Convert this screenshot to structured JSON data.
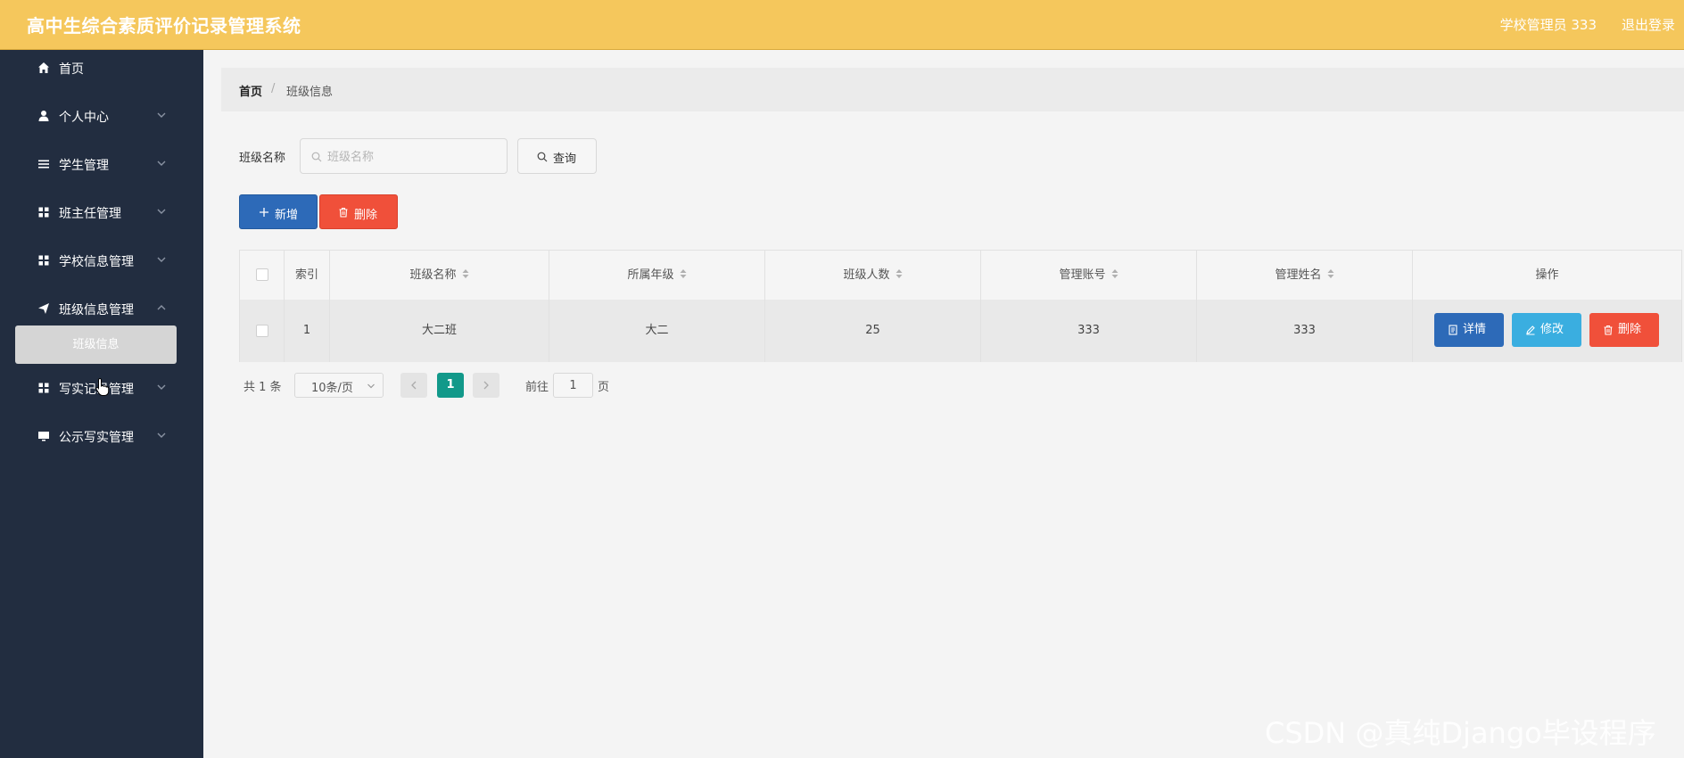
{
  "header": {
    "title": "高中生综合素质评价记录管理系统",
    "user": "学校管理员 333",
    "logout": "退出登录"
  },
  "sidebar": {
    "items": [
      {
        "label": "首页",
        "icon": "home-icon"
      },
      {
        "label": "个人中心",
        "icon": "user-icon"
      },
      {
        "label": "学生管理",
        "icon": "list-icon"
      },
      {
        "label": "班主任管理",
        "icon": "grid-icon"
      },
      {
        "label": "学校信息管理",
        "icon": "grid-icon"
      },
      {
        "label": "班级信息管理",
        "icon": "send-icon"
      },
      {
        "label": "写实记录管理",
        "icon": "grid-icon"
      },
      {
        "label": "公示写实管理",
        "icon": "monitor-icon"
      }
    ],
    "active_sub": "班级信息"
  },
  "breadcrumb": {
    "home": "首页",
    "separator": "/",
    "current": "班级信息"
  },
  "search": {
    "label": "班级名称",
    "placeholder": "班级名称",
    "value": "",
    "button": "查询"
  },
  "actions": {
    "add": "新增",
    "delete": "删除"
  },
  "table": {
    "columns": [
      "索引",
      "班级名称",
      "所属年级",
      "班级人数",
      "管理账号",
      "管理姓名",
      "操作"
    ],
    "rows": [
      {
        "index": "1",
        "class_name": "大二班",
        "grade": "大二",
        "count": "25",
        "account": "333",
        "manager": "333"
      }
    ],
    "row_actions": {
      "detail": "详情",
      "edit": "修改",
      "delete": "删除"
    }
  },
  "pagination": {
    "total": "共 1 条",
    "page_size": "10条/页",
    "current": "1",
    "goto_label": "前往",
    "goto_value": "1",
    "page_suffix": "页"
  },
  "watermark": "CSDN @真纯Django毕设程序",
  "colors": {
    "header": "#f5c75c",
    "sidebar": "#222d40",
    "primary": "#2d6ab8",
    "info": "#3aaee0",
    "danger": "#f0503a",
    "page_active": "#12998a"
  }
}
